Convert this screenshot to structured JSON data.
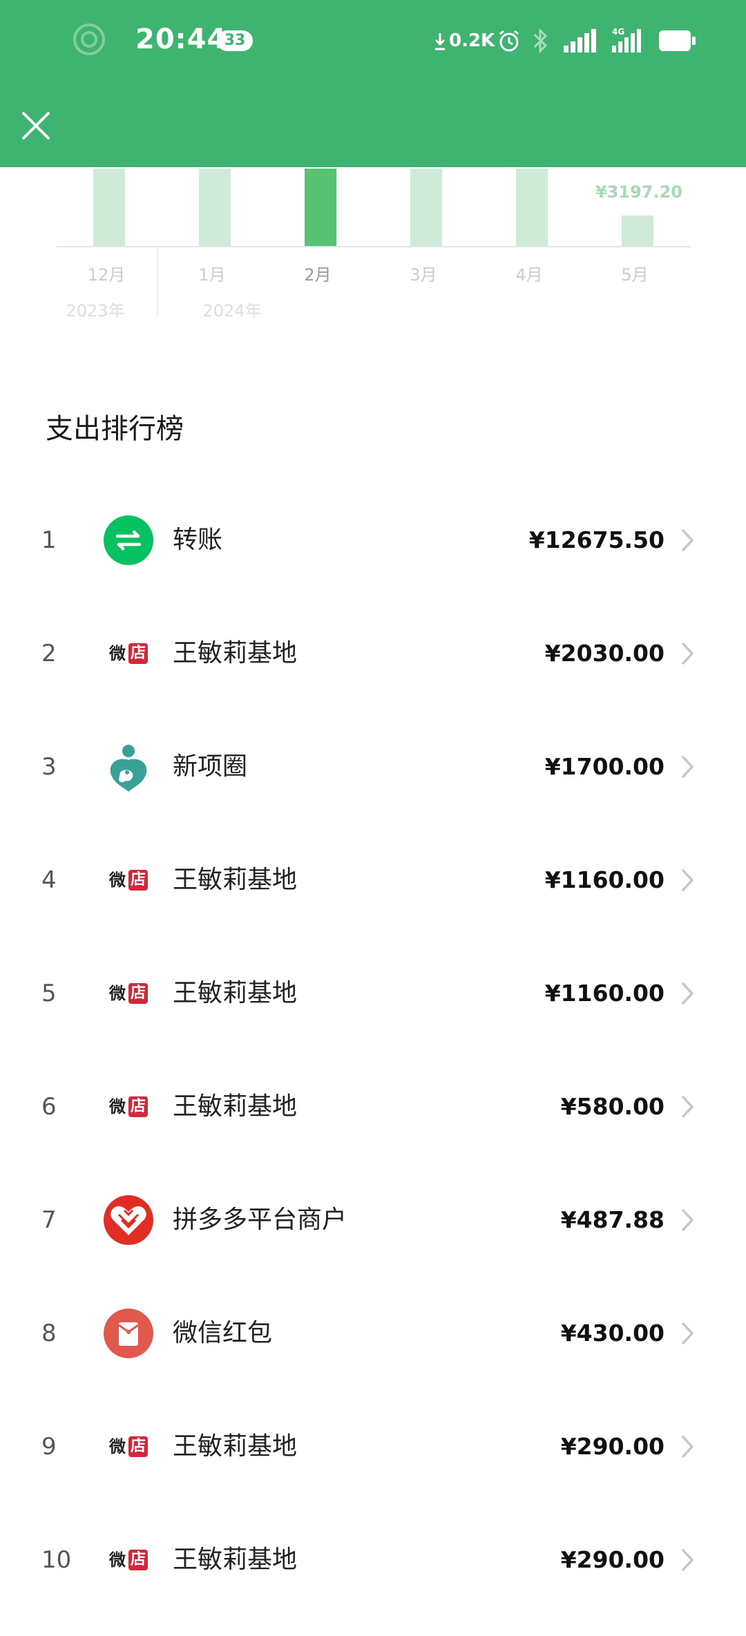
{
  "status_bar": {
    "time": "20:44",
    "notification_count": "33",
    "net_speed": "0.2K",
    "icons": [
      "ring-icon",
      "download-arrow-icon",
      "alarm-icon",
      "bluetooth-icon",
      "signal-icon",
      "signal-4g-icon",
      "battery-icon"
    ],
    "battery_color": "#ffffff"
  },
  "header": {
    "close_icon": "close-icon",
    "color": "#3fb370"
  },
  "chart_data": {
    "type": "bar",
    "categories": [
      "12月",
      "1月",
      "2月",
      "3月",
      "4月",
      "5月"
    ],
    "year_labels": [
      "2023年",
      "2024年"
    ],
    "highlighted_category": "2月",
    "visible_value_label": "¥3197.20",
    "colors": {
      "bar": "#cfead7",
      "highlight": "#57c272",
      "label": "#a7d9b5"
    }
  },
  "ranking": {
    "title": "支出排行榜",
    "items": [
      {
        "rank": "1",
        "name": "转账",
        "amount": "¥12675.50",
        "icon": "transfer-icon"
      },
      {
        "rank": "2",
        "name": "王敏莉基地",
        "amount": "¥2030.00",
        "icon": "weidian-icon"
      },
      {
        "rank": "3",
        "name": "新项圈",
        "amount": "¥1700.00",
        "icon": "mother-child-logo-icon"
      },
      {
        "rank": "4",
        "name": "王敏莉基地",
        "amount": "¥1160.00",
        "icon": "weidian-icon"
      },
      {
        "rank": "5",
        "name": "王敏莉基地",
        "amount": "¥1160.00",
        "icon": "weidian-icon"
      },
      {
        "rank": "6",
        "name": "王敏莉基地",
        "amount": "¥580.00",
        "icon": "weidian-icon"
      },
      {
        "rank": "7",
        "name": "拼多多平台商户",
        "amount": "¥487.88",
        "icon": "pinduoduo-icon"
      },
      {
        "rank": "8",
        "name": "微信红包",
        "amount": "¥430.00",
        "icon": "red-packet-icon"
      },
      {
        "rank": "9",
        "name": "王敏莉基地",
        "amount": "¥290.00",
        "icon": "weidian-icon"
      },
      {
        "rank": "10",
        "name": "王敏莉基地",
        "amount": "¥290.00",
        "icon": "weidian-icon"
      }
    ],
    "weidian_text": [
      "微",
      "店"
    ]
  }
}
